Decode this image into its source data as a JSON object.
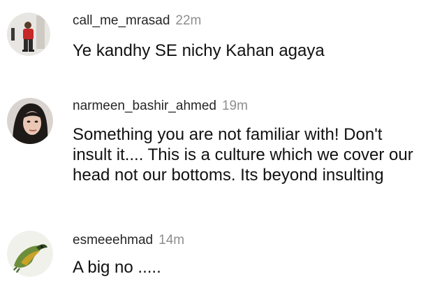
{
  "comments": [
    {
      "username": "call_me_mrasad",
      "time": "22m",
      "text": "Ye kandhy SE nichy Kahan agaya",
      "avatar_icon": "person-photo-avatar"
    },
    {
      "username": "narmeen_bashir_ahmed",
      "time": "19m",
      "text": "Something you are not familiar with! Don't insult it.... This is a culture which we cover our head not our bottoms. Its beyond insulting",
      "avatar_icon": "woman-photo-avatar"
    },
    {
      "username": "esmeeehmad",
      "time": "14m",
      "text": "A big no .....",
      "avatar_icon": "bird-photo-avatar"
    }
  ],
  "colors": {
    "username": "#262626",
    "time": "#8e8e8e",
    "text": "#111111"
  }
}
